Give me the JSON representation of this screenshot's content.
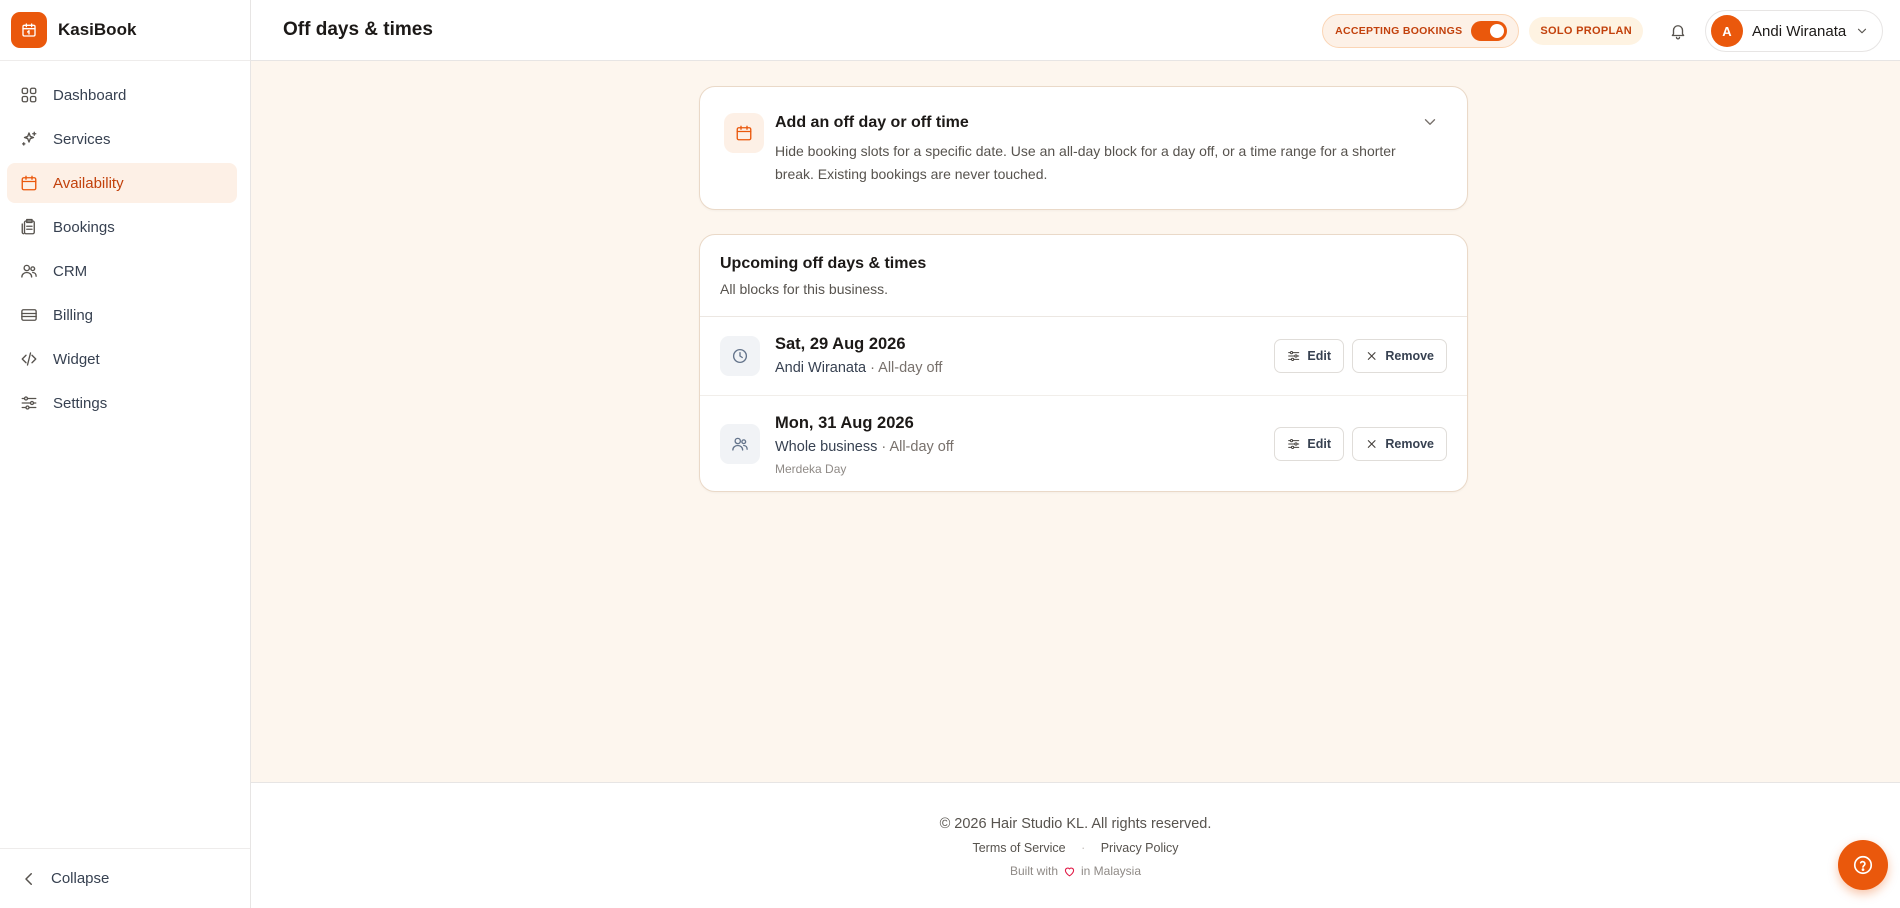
{
  "app": {
    "name": "KasiBook",
    "logo_icon": "calendar-icon",
    "accent": "#ea580c"
  },
  "sidebar": {
    "items": [
      {
        "label": "Dashboard",
        "icon": "grid-icon",
        "active": false
      },
      {
        "label": "Services",
        "icon": "sparkles-icon",
        "active": false
      },
      {
        "label": "Availability",
        "icon": "calendar-icon",
        "active": true
      },
      {
        "label": "Bookings",
        "icon": "clipboard-icon",
        "active": false
      },
      {
        "label": "CRM",
        "icon": "users-icon",
        "active": false
      },
      {
        "label": "Billing",
        "icon": "card-icon",
        "active": false
      },
      {
        "label": "Widget",
        "icon": "code-icon",
        "active": false
      },
      {
        "label": "Settings",
        "icon": "sliders-icon",
        "active": false
      }
    ],
    "collapse_label": "Collapse"
  },
  "header": {
    "title": "Off days & times",
    "accepting_label": "ACCEPTING BOOKINGS",
    "accepting_on": true,
    "plan_label": "SOLO PROPLAN",
    "user": {
      "initial": "A",
      "name": "Andi Wiranata"
    }
  },
  "add_card": {
    "title": "Add an off day or off time",
    "description": "Hide booking slots for a specific date. Use an all-day block for a day off, or a time range for a shorter break. Existing bookings are never touched."
  },
  "list": {
    "title": "Upcoming off days & times",
    "subtitle": "All blocks for this business.",
    "edit_label": "Edit",
    "remove_label": "Remove",
    "rows": [
      {
        "date": "Sat, 29 Aug 2026",
        "who": "Andi Wiranata",
        "kind": "· All-day off",
        "note": "",
        "icon": "clock-icon"
      },
      {
        "date": "Mon, 31 Aug 2026",
        "who": "Whole business",
        "kind": "· All-day off",
        "note": "Merdeka Day",
        "icon": "users-icon"
      }
    ]
  },
  "footer": {
    "copyright": "© 2026 Hair Studio KL. All rights reserved.",
    "terms": "Terms of Service",
    "separator": "·",
    "privacy": "Privacy Policy",
    "built_prefix": "Built with",
    "built_suffix": "in Malaysia"
  }
}
